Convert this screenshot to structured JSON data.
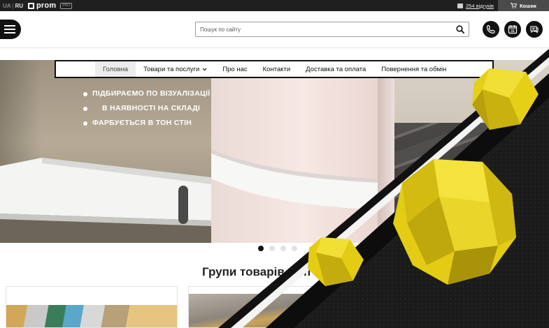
{
  "topbar": {
    "lang_active": "UA",
    "lang_sep": "|",
    "lang_other": "RU",
    "logo_text": "prom",
    "logo_badge": "PRO",
    "reviews_label": "254 відгуків",
    "cart_label": "Кошик"
  },
  "header": {
    "search_placeholder": "Пошук по сайту"
  },
  "nav": {
    "items": [
      {
        "label": "Головна"
      },
      {
        "label": "Товари та послуги"
      },
      {
        "label": "Про нас"
      },
      {
        "label": "Контакти"
      },
      {
        "label": "Доставка та оплата"
      },
      {
        "label": "Повернення та обмін"
      }
    ]
  },
  "hero": {
    "bullets": [
      "ПІДБИРАЄМО ПО ВІЗУАЛІЗАЦІЇ",
      "В НАЯВНОСТІ НА СКЛАДІ",
      "ФАРБУЄТЬСЯ В ТОН СТІН"
    ]
  },
  "main": {
    "section_title": "Групи товарів та п"
  },
  "colors": {
    "topbar_bg": "#1f1f1f",
    "accent_yellow": "#e8d21c",
    "dark": "#111111"
  }
}
